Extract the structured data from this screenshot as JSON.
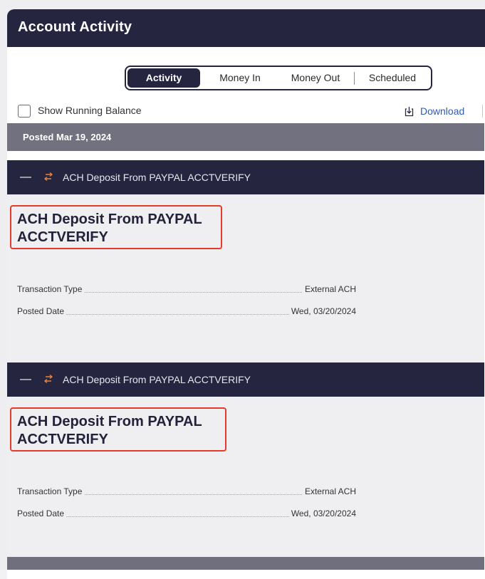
{
  "header": {
    "title": "Account Activity"
  },
  "tabs": [
    {
      "label": "Activity",
      "active": true
    },
    {
      "label": "Money In",
      "active": false
    },
    {
      "label": "Money Out",
      "active": false
    },
    {
      "label": "Scheduled",
      "active": false
    }
  ],
  "options": {
    "running_balance_label": "Show Running Balance",
    "running_balance_checked": false,
    "download_label": "Download"
  },
  "date_group": {
    "label": "Posted Mar 19, 2024"
  },
  "transactions": [
    {
      "bar_label": "ACH Deposit From PAYPAL ACCTVERIFY",
      "title_line1": "ACH Deposit From PAYPAL",
      "title_line2": "ACCTVERIFY",
      "details": [
        {
          "label": "Transaction Type",
          "value": "External ACH"
        },
        {
          "label": "Posted Date",
          "value": "Wed, 03/20/2024"
        }
      ]
    },
    {
      "bar_label": "ACH Deposit From PAYPAL ACCTVERIFY",
      "title_line1": "ACH Deposit From PAYPAL",
      "title_line2": "ACCTVERIFY",
      "details": [
        {
          "label": "Transaction Type",
          "value": "External ACH"
        },
        {
          "label": "Posted Date",
          "value": "Wed, 03/20/2024"
        }
      ]
    }
  ],
  "colors": {
    "navy": "#25253f",
    "highlight_border": "#e53a2c",
    "link": "#2f5bb3",
    "swap_icon": "#e8833a"
  },
  "icons": [
    "download-icon",
    "swap-arrows-icon",
    "collapse-icon",
    "checkbox"
  ]
}
